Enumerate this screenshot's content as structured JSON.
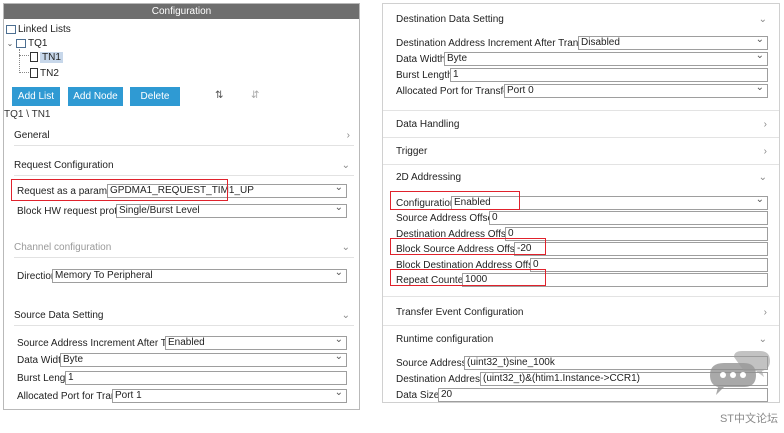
{
  "config_title": "Configuration",
  "tree": {
    "root": "Linked Lists",
    "queue": "TQ1",
    "nodes": [
      "TN1",
      "TN2"
    ],
    "selected": "TN1"
  },
  "buttons": {
    "add_list": "Add List",
    "add_node": "Add Node",
    "delete": "Delete"
  },
  "breadcrumb": "TQ1 \\ TN1",
  "left": {
    "general": "General",
    "request_config": "Request Configuration",
    "request_param_label": "Request as a parameter",
    "request_param_value": "GPDMA1_REQUEST_TIM1_UP",
    "block_hw_label": "Block HW request protocol",
    "block_hw_value": "Single/Burst Level",
    "channel_config": "Channel configuration",
    "direction_label": "Direction",
    "direction_value": "Memory To Peripheral",
    "source_data_setting": "Source Data Setting",
    "src_incr_label": "Source Address Increment After Transfer",
    "src_incr_value": "Enabled",
    "data_width_label": "Data Width",
    "data_width_value": "Byte",
    "burst_length_label": "Burst Length",
    "burst_length_value": "1",
    "alloc_port_label": "Allocated Port for Transfer",
    "alloc_port_value": "Port 1"
  },
  "right": {
    "dest_data_setting": "Destination Data Setting",
    "dst_incr_label": "Destination Address Increment After Transfer",
    "dst_incr_value": "Disabled",
    "data_width_label": "Data Width",
    "data_width_value": "Byte",
    "burst_length_label": "Burst Length",
    "burst_length_value": "1",
    "alloc_port_label": "Allocated Port for Transfer",
    "alloc_port_value": "Port 0",
    "data_handling": "Data Handling",
    "trigger": "Trigger",
    "addr_2d": "2D Addressing",
    "configuration_label": "Configuration",
    "configuration_value": "Enabled",
    "src_offset_label": "Source Address Offset",
    "src_offset_value": "0",
    "dst_offset_label": "Destination Address Offset",
    "dst_offset_value": "0",
    "block_src_offset_label": "Block Source Address Offset",
    "block_src_offset_value": "-20",
    "block_dst_offset_label": "Block Destination Address Offset",
    "block_dst_offset_value": "0",
    "repeat_counter_label": "Repeat Counter",
    "repeat_counter_value": "1000",
    "transfer_event": "Transfer Event Configuration",
    "runtime_config": "Runtime configuration",
    "src_addr_label": "Source Address",
    "src_addr_value": "(uint32_t)sine_100k",
    "dst_addr_label": "Destination Address",
    "dst_addr_value": "(uint32_t)&(htim1.Instance->CCR1)",
    "data_size_label": "Data Size",
    "data_size_value": "20"
  },
  "watermark": "ST中文论坛",
  "colors": {
    "button": "#2f9ad3",
    "highlight": "#e0222c",
    "header": "#6e6e6e"
  }
}
